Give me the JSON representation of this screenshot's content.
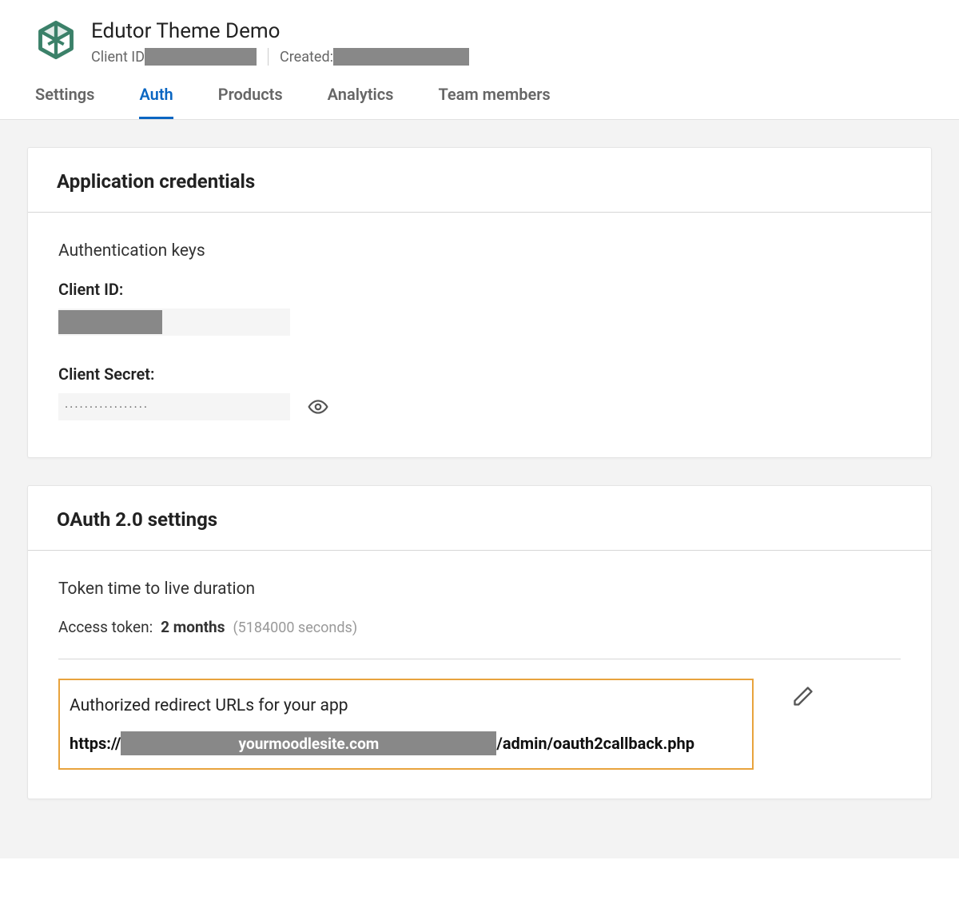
{
  "header": {
    "app_title": "Edutor Theme Demo",
    "client_id_label": "Client ID",
    "created_label": "Created:"
  },
  "tabs": {
    "settings": "Settings",
    "auth": "Auth",
    "products": "Products",
    "analytics": "Analytics",
    "team": "Team members",
    "active": "auth"
  },
  "credentials_card": {
    "title": "Application credentials",
    "section_title": "Authentication keys",
    "client_id_label": "Client ID:",
    "client_secret_label": "Client Secret:",
    "client_secret_mask": "·················"
  },
  "oauth_card": {
    "title": "OAuth 2.0 settings",
    "token_heading": "Token time to live duration",
    "access_token_label": "Access token:",
    "access_token_value": "2 months",
    "access_token_seconds": "(5184000 seconds)",
    "redirect_heading": "Authorized redirect URLs for your app",
    "url_prefix": "https://",
    "url_redacted_text": "yourmoodlesite.com",
    "url_suffix": "/admin/oauth2callback.php"
  }
}
